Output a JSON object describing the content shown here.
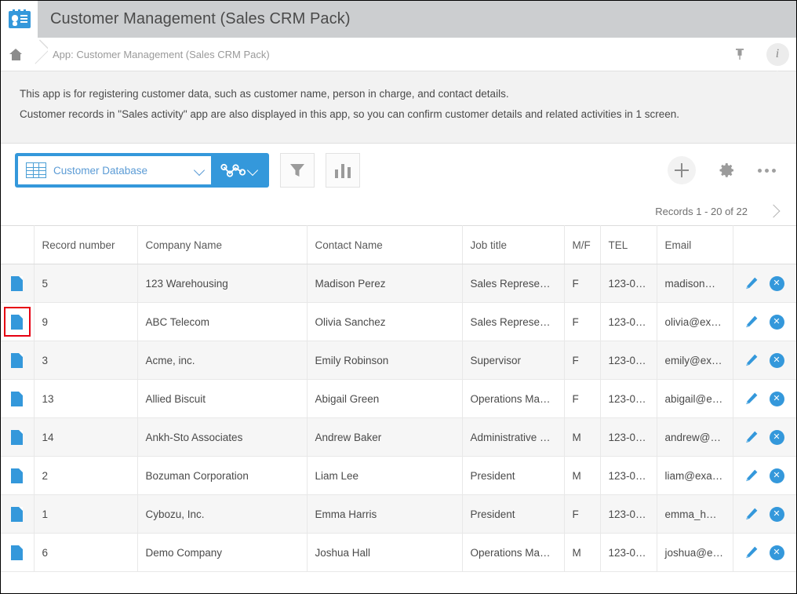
{
  "titlebar": {
    "app_icon": "contact-card-icon",
    "title": "Customer Management (Sales CRM Pack)"
  },
  "breadcrumb": {
    "home_icon": "home-icon",
    "path": "App: Customer Management (Sales CRM Pack)",
    "pin_icon": "pin-icon",
    "pin_glyph": "⊥",
    "info_icon": "info-icon",
    "info_glyph": "i"
  },
  "description": {
    "line1": "This app is for registering customer data, such as customer name, person in charge, and contact details.",
    "line2": "Customer records in \"Sales activity\" app are also displayed in this app, so you can confirm customer details and related activities in 1 screen."
  },
  "toolbar": {
    "view_name": "Customer Database",
    "view_icon": "table-view-icon",
    "view_chevron": "chevron-down-icon",
    "graph_icon": "graph-view-icon",
    "graph_chevron": "chevron-down-icon",
    "filter_icon": "filter-funnel-icon",
    "chart_icon": "bar-chart-icon",
    "add_icon": "plus-icon",
    "settings_icon": "gear-icon",
    "more_icon": "ellipsis-icon",
    "accent_color": "#3498db"
  },
  "pagination": {
    "records_label": "Records 1 - 20 of 22",
    "next_icon": "chevron-right-icon"
  },
  "table": {
    "headers": [
      "",
      "Record number",
      "Company Name",
      "Contact Name",
      "Job title",
      "M/F",
      "TEL",
      "Email",
      ""
    ],
    "rows": [
      {
        "doc_icon": "document-icon",
        "highlighted": false,
        "record_number": "5",
        "company": "123 Warehousing",
        "contact": "Madison Perez",
        "job_title": "Sales Represe…",
        "mf": "F",
        "tel": "123-0…",
        "email": "madison…",
        "edit_icon": "pencil-icon",
        "delete_icon": "delete-circle-icon"
      },
      {
        "doc_icon": "document-icon",
        "highlighted": true,
        "record_number": "9",
        "company": "ABC Telecom",
        "contact": "Olivia Sanchez",
        "job_title": "Sales Represe…",
        "mf": "F",
        "tel": "123-0…",
        "email": "olivia@ex…",
        "edit_icon": "pencil-icon",
        "delete_icon": "delete-circle-icon"
      },
      {
        "doc_icon": "document-icon",
        "highlighted": false,
        "record_number": "3",
        "company": "Acme, inc.",
        "contact": "Emily Robinson",
        "job_title": "Supervisor",
        "mf": "F",
        "tel": "123-0…",
        "email": "emily@ex…",
        "edit_icon": "pencil-icon",
        "delete_icon": "delete-circle-icon"
      },
      {
        "doc_icon": "document-icon",
        "highlighted": false,
        "record_number": "13",
        "company": "Allied Biscuit",
        "contact": "Abigail Green",
        "job_title": "Operations Ma…",
        "mf": "F",
        "tel": "123-0…",
        "email": "abigail@e…",
        "edit_icon": "pencil-icon",
        "delete_icon": "delete-circle-icon"
      },
      {
        "doc_icon": "document-icon",
        "highlighted": false,
        "record_number": "14",
        "company": "Ankh-Sto Associates",
        "contact": "Andrew Baker",
        "job_title": "Administrative …",
        "mf": "M",
        "tel": "123-0…",
        "email": "andrew@…",
        "edit_icon": "pencil-icon",
        "delete_icon": "delete-circle-icon"
      },
      {
        "doc_icon": "document-icon",
        "highlighted": false,
        "record_number": "2",
        "company": "Bozuman Corporation",
        "contact": "Liam Lee",
        "job_title": "President",
        "mf": "M",
        "tel": "123-0…",
        "email": "liam@exa…",
        "edit_icon": "pencil-icon",
        "delete_icon": "delete-circle-icon"
      },
      {
        "doc_icon": "document-icon",
        "highlighted": false,
        "record_number": "1",
        "company": "Cybozu, Inc.",
        "contact": "Emma Harris",
        "job_title": "President",
        "mf": "F",
        "tel": "123-0…",
        "email": "emma_h…",
        "edit_icon": "pencil-icon",
        "delete_icon": "delete-circle-icon"
      },
      {
        "doc_icon": "document-icon",
        "highlighted": false,
        "record_number": "6",
        "company": "Demo Company",
        "contact": "Joshua Hall",
        "job_title": "Operations Ma…",
        "mf": "M",
        "tel": "123-0…",
        "email": "joshua@e…",
        "edit_icon": "pencil-icon",
        "delete_icon": "delete-circle-icon"
      }
    ]
  }
}
